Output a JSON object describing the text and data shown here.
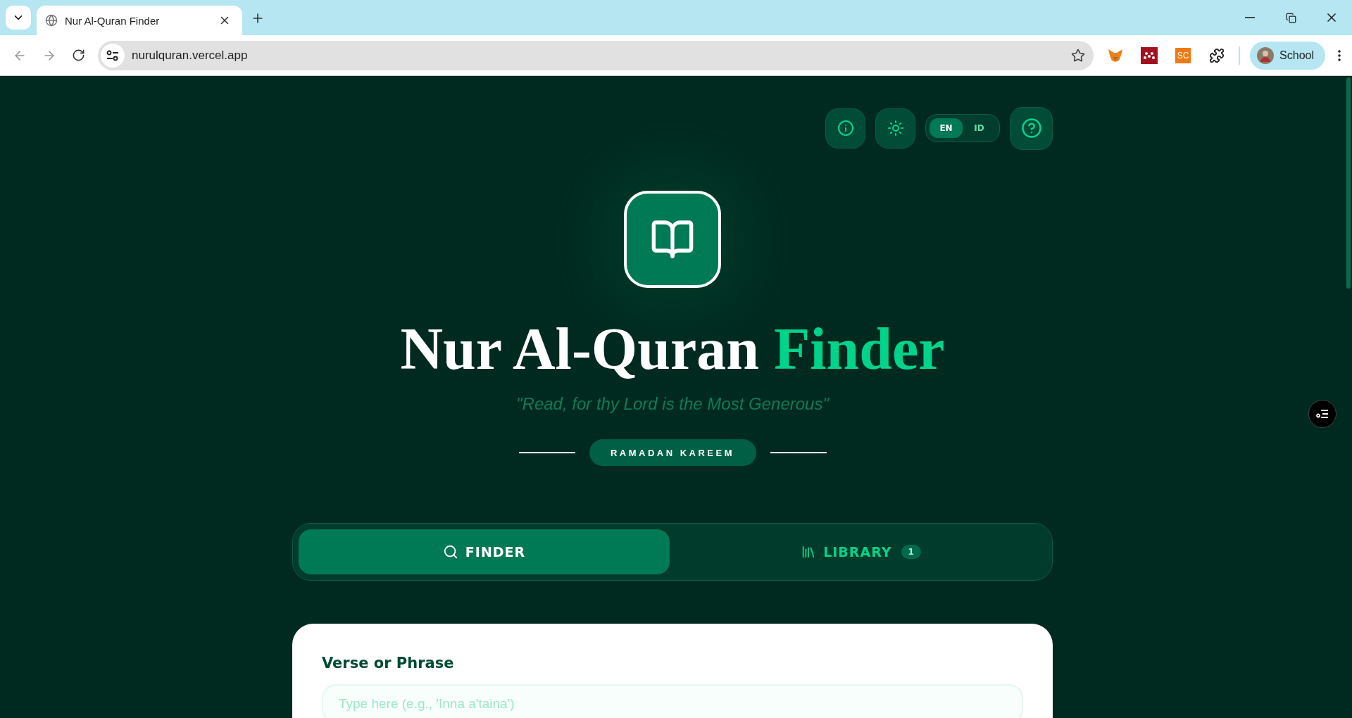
{
  "browser": {
    "tabs": [
      {
        "title": "Nur Al-Quran Finder",
        "selected": true
      }
    ],
    "url": "nurulquran.vercel.app",
    "extensions": [
      {
        "kind": "fox"
      },
      {
        "kind": "grid"
      },
      {
        "kind": "text",
        "label": "SC"
      },
      {
        "kind": "puzzle"
      }
    ],
    "profile": "School"
  },
  "header": {
    "languages": [
      {
        "label": "EN",
        "selected": true
      },
      {
        "label": "ID",
        "selected": false
      }
    ]
  },
  "hero": {
    "title": "Nur Al-Quran",
    "title_accent": "Finder",
    "quote": "\"Read, for thy Lord is the Most Generous\"",
    "badge": "RAMADAN KAREEM"
  },
  "nav_tabs": [
    {
      "label": "FINDER",
      "kind": "search",
      "selected": true
    },
    {
      "label": "LIBRARY",
      "kind": "library",
      "selected": false,
      "count": "1"
    }
  ],
  "form": {
    "label": "Verse or Phrase",
    "placeholder": "Type here (e.g., 'Inna a'taina')"
  }
}
